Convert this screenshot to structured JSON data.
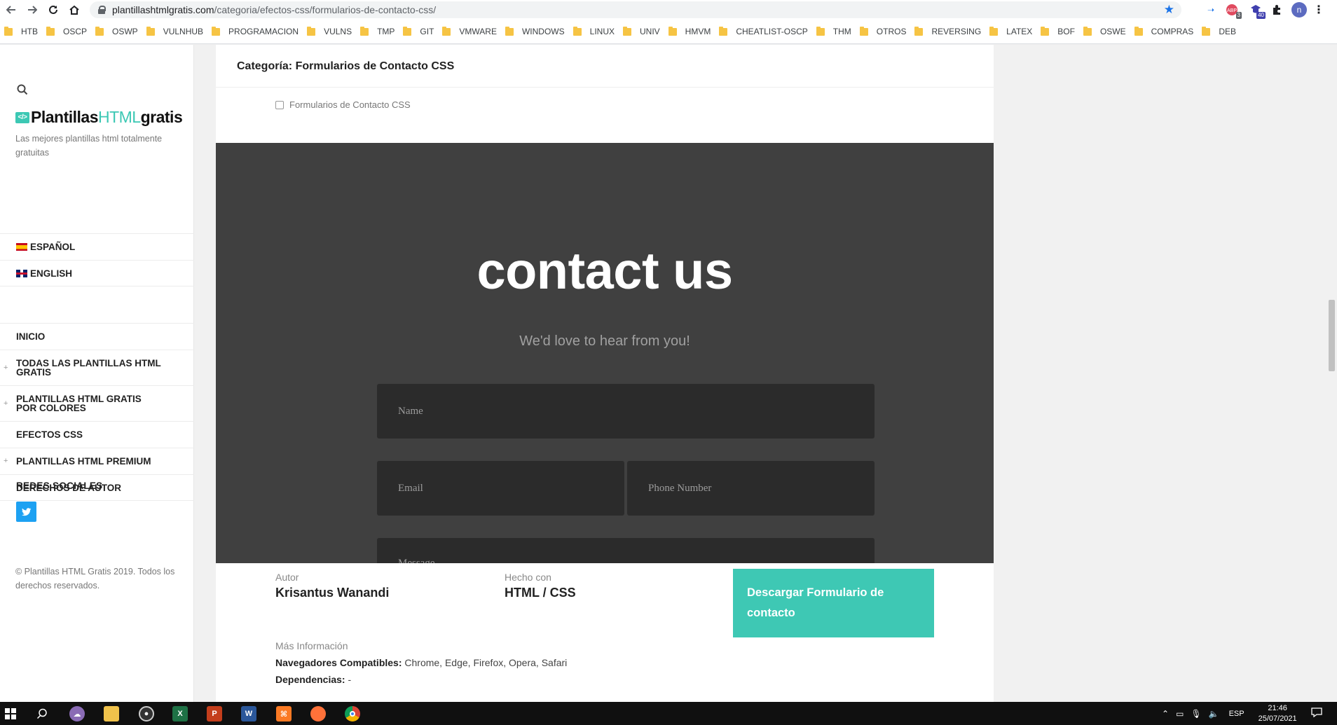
{
  "browser": {
    "url_host": "plantillashtmlgratis.com",
    "url_path": "/categoria/efectos-css/formularios-de-contacto-css/",
    "extensions": [
      {
        "name": "adblock-extension-icon",
        "badge": "3"
      },
      {
        "name": "shield-extension-icon",
        "badge": "40"
      }
    ],
    "profile_initial": "n",
    "bookmarks": [
      "HTB",
      "OSCP",
      "OSWP",
      "VULNHUB",
      "PROGRAMACION",
      "VULNS",
      "TMP",
      "GIT",
      "VMWARE",
      "WINDOWS",
      "LINUX",
      "UNIV",
      "HMVM",
      "CHEATLIST-OSCP",
      "THM",
      "OTROS",
      "REVERSING",
      "LATEX",
      "BOF",
      "OSWE",
      "COMPRAS",
      "DEB"
    ]
  },
  "sidebar": {
    "logo_main": "Plantillas",
    "logo_accent": "HTML",
    "logo_tail": "gratis",
    "logo_badge": "</>",
    "tagline": "Las mejores plantillas html totalmente gratuitas",
    "languages": [
      {
        "label": "ESPAÑOL"
      },
      {
        "label": "ENGLISH"
      }
    ],
    "menu": [
      {
        "label": "INICIO",
        "expandable": false
      },
      {
        "label": "TODAS LAS PLANTILLAS HTML GRATIS",
        "expandable": true
      },
      {
        "label": "PLANTILLAS HTML GRATIS POR COLORES",
        "expandable": true
      },
      {
        "label": "EFECTOS CSS",
        "expandable": false
      },
      {
        "label": "PLANTILLAS HTML PREMIUM",
        "expandable": true
      },
      {
        "label": "DERECHOS DE AUTOR",
        "expandable": false
      }
    ],
    "social_title": "REDES SOCIALES",
    "copyright": "© Plantillas HTML Gratis 2019. Todos los derechos reservados."
  },
  "content": {
    "category_title": "Categoría: Formularios de Contacto CSS",
    "category_link": "Formularios de Contacto CSS",
    "preview": {
      "heading": "contact us",
      "subheading": "We'd love to hear from you!",
      "name_placeholder": "Name",
      "email_placeholder": "Email",
      "phone_placeholder": "Phone Number",
      "message_placeholder": "Message"
    },
    "meta": {
      "author_label": "Autor",
      "author_value": "Krisantus Wanandi",
      "made_with_label": "Hecho con",
      "made_with_value": "HTML / CSS",
      "download_label": "Descargar Formulario de contacto"
    },
    "more_info_label": "Más Información",
    "browsers_label": "Navegadores Compatibles:",
    "browsers_value": " Chrome, Edge, Firefox, Opera, Safari",
    "deps_label": "Dependencias:",
    "deps_value": " -"
  },
  "taskbar": {
    "apps": [
      "search",
      "app-cloud",
      "file-explorer",
      "media-player",
      "excel",
      "powerpoint",
      "word",
      "xampp",
      "firefox",
      "chrome"
    ],
    "language": "ESP",
    "time": "21:46",
    "date": "25/07/2021"
  },
  "colors": {
    "accent": "#3ec8b4",
    "preview_bg": "#404040",
    "field_bg": "#2b2b2b",
    "twitter": "#1da1f2"
  }
}
